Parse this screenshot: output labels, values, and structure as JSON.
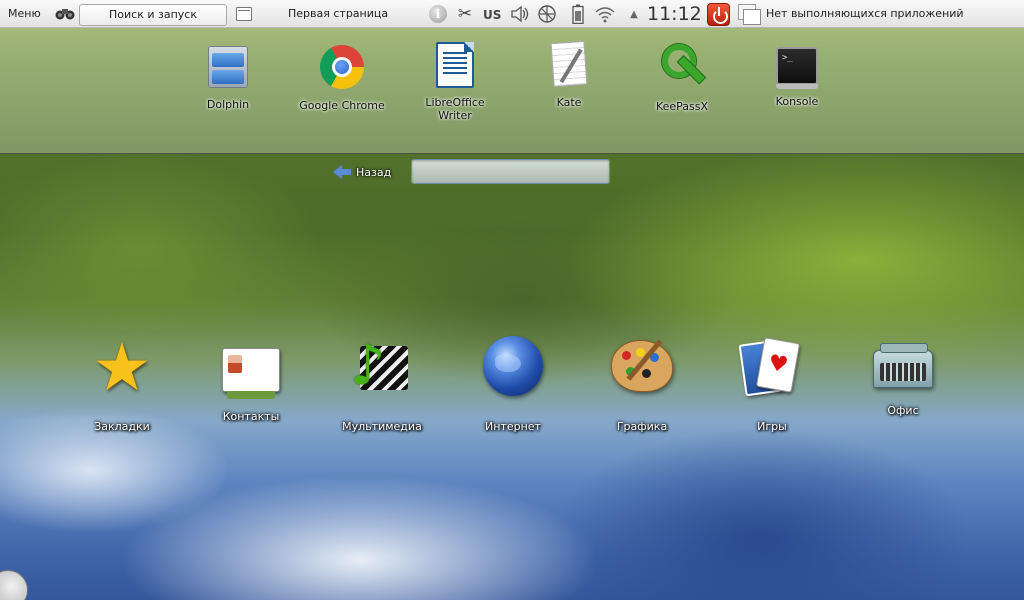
{
  "panel": {
    "menu_label": "Меню",
    "search_label": "Поиск и запуск",
    "first_page_label": "Первая страница",
    "keyboard_layout": "US",
    "clock": "11:12",
    "tasks_label": "Нет выполняющихся приложений"
  },
  "favorites": [
    {
      "label": "Dolphin",
      "icon": "file-manager-icon"
    },
    {
      "label": "Google Chrome",
      "icon": "chrome-icon"
    },
    {
      "label": "LibreOffice Writer",
      "icon": "writer-icon"
    },
    {
      "label": "Kate",
      "icon": "text-editor-icon"
    },
    {
      "label": "KeePassX",
      "icon": "key-icon"
    },
    {
      "label": "Konsole",
      "icon": "terminal-icon"
    }
  ],
  "navigation": {
    "back_label": "Назад",
    "filter_value": ""
  },
  "categories": [
    {
      "label": "Закладки",
      "icon": "star-icon"
    },
    {
      "label": "Контакты",
      "icon": "contacts-icon"
    },
    {
      "label": "Мультимедиа",
      "icon": "multimedia-icon"
    },
    {
      "label": "Интернет",
      "icon": "globe-icon"
    },
    {
      "label": "Графика",
      "icon": "palette-icon"
    },
    {
      "label": "Игры",
      "icon": "cards-icon"
    },
    {
      "label": "Офис",
      "icon": "typewriter-icon"
    }
  ],
  "colors": {
    "panel_bg": "#e8e8e8",
    "power_red": "#d63b1f",
    "accent_blue": "#5b8ad6"
  }
}
